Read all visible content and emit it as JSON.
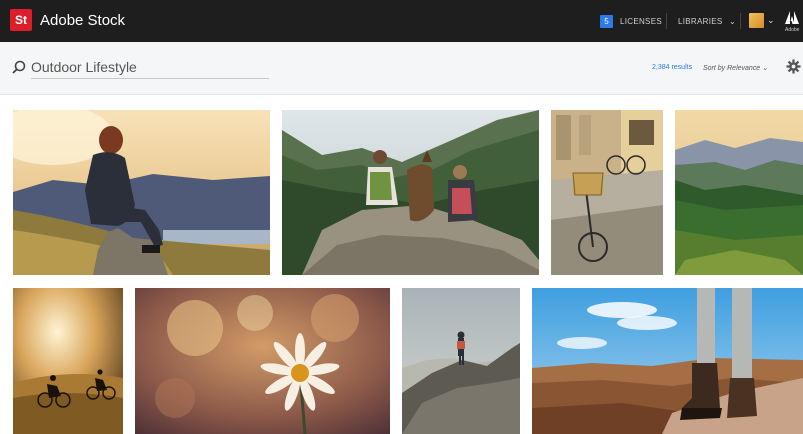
{
  "header": {
    "logo_text": "St",
    "app_title": "Adobe Stock",
    "license_count": "5",
    "licenses_label": "LICENSES",
    "libraries_label": "LIBRARIES",
    "libraries_caret": "⌄",
    "avatar_caret": "⌄",
    "adobe_label": "Adobe"
  },
  "search": {
    "query": "Outdoor Lifestyle",
    "results_count": "2,384 results",
    "sort_label": "Sort by Relevance ⌄"
  },
  "colors": {
    "brand_red": "#dc1e2b",
    "accent_blue": "#2d7be5",
    "topbar_bg": "#1e1e1e"
  },
  "icons": [
    "search-icon",
    "gear-icon",
    "chevron-down-icon",
    "adobe-logo-icon",
    "user-avatar"
  ],
  "grid": {
    "rows": [
      {
        "images": [
          {
            "name": "woman-sitting-on-hill-sunset"
          },
          {
            "name": "hikers-with-dog-on-rock"
          },
          {
            "name": "bicycle-with-basket-alley"
          },
          {
            "name": "mountain-valley-forest"
          }
        ]
      },
      {
        "images": [
          {
            "name": "cyclists-sunset-field"
          },
          {
            "name": "daisy-flower-closeup"
          },
          {
            "name": "hiker-on-rock-summit"
          },
          {
            "name": "hiking-boots-legs-canyon"
          }
        ]
      }
    ]
  }
}
